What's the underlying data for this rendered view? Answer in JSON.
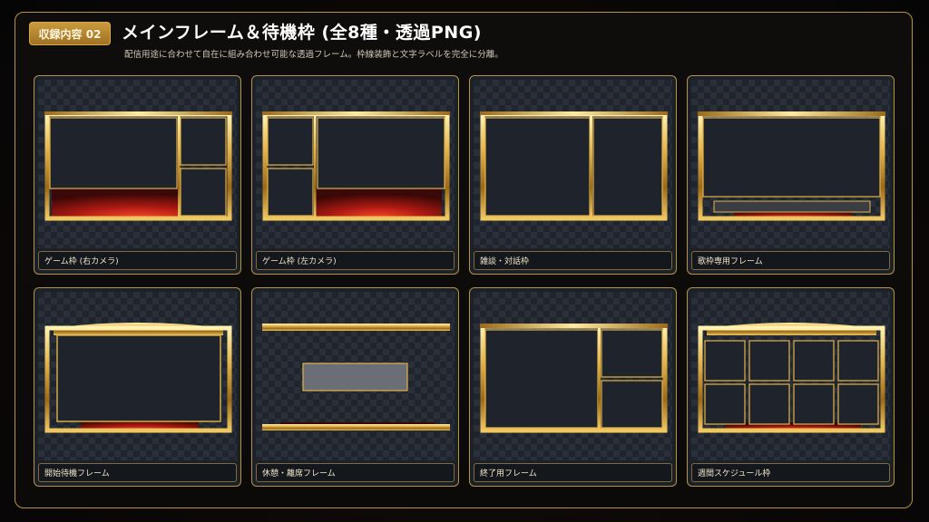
{
  "header": {
    "badge": "収録内容 02",
    "title": "メインフレーム＆待機枠 (全8種・透過PNG)",
    "subtitle": "配信用途に合わせて自在に組み合わせ可能な透過フレーム。枠線装飾と文字ラベルを完全に分離。"
  },
  "cards": [
    {
      "label": "ゲーム枠 (右カメラ)"
    },
    {
      "label": "ゲーム枠 (左カメラ)"
    },
    {
      "label": "雑談・対話枠"
    },
    {
      "label": "歌枠専用フレーム"
    },
    {
      "label": "開始待機フレーム"
    },
    {
      "label": "休憩・離席フレーム"
    },
    {
      "label": "終了用フレーム"
    },
    {
      "label": "週間スケジュール枠"
    }
  ],
  "colors": {
    "gold": "#d9a93c",
    "accent_red": "#c8231d",
    "card_bg": "#1c2027"
  }
}
